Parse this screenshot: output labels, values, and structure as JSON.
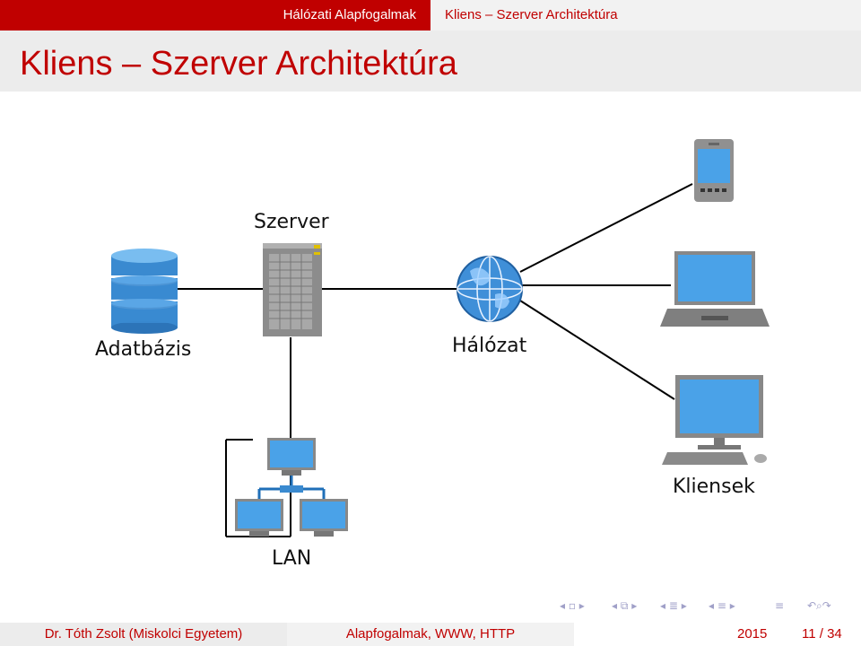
{
  "header": {
    "section": "Hálózati Alapfogalmak",
    "subsection": "Kliens – Szerver Architektúra"
  },
  "frame": {
    "title": "Kliens – Szerver Architektúra"
  },
  "diagram": {
    "labels": {
      "server": "Szerver",
      "database": "Adatbázis",
      "network": "Hálózat",
      "clients": "Kliensek",
      "lan": "LAN"
    },
    "colors": {
      "blue_light": "#4a9fe0",
      "blue_dark": "#1f6fb8",
      "gray": "#808080",
      "line": "#000000"
    }
  },
  "footer": {
    "author": "Dr. Tóth Zsolt (Miskolci Egyetem)",
    "talk": "Alapfogalmak, WWW, HTTP",
    "year": "2015",
    "page": "11 / 34"
  },
  "nav_icons": [
    "nav-first-icon",
    "nav-frame-icon",
    "nav-subsection-icon",
    "nav-section-icon",
    "nav-search-icon"
  ]
}
